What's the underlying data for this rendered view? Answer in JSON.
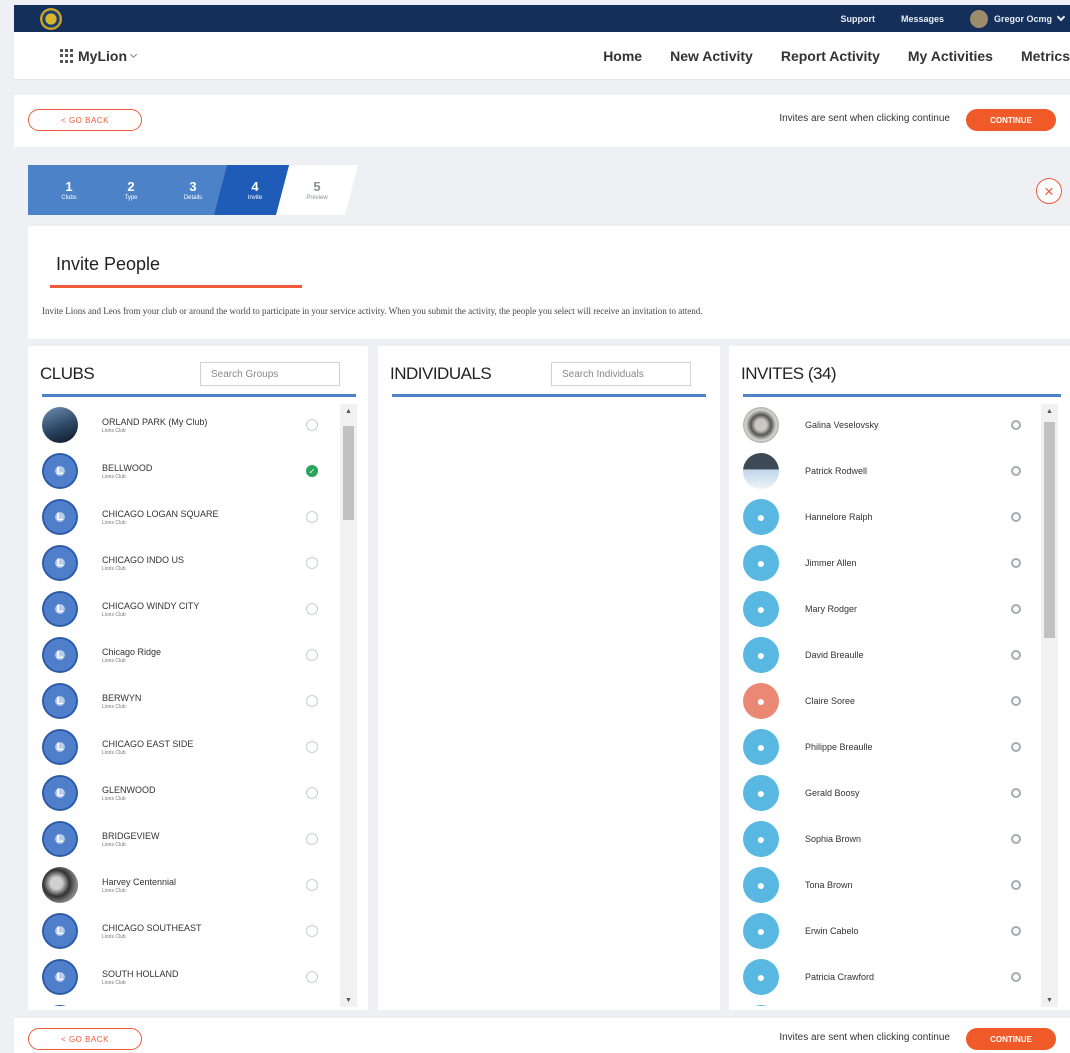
{
  "topbar": {
    "links": [
      "Support",
      "Messages"
    ],
    "user_name": "Gregor Ocmg"
  },
  "navbar": {
    "brand": "MyLion",
    "links": [
      "Home",
      "New Activity",
      "Report Activity",
      "My Activities",
      "Metrics"
    ]
  },
  "action_bar": {
    "back_label": "< GO BACK",
    "hint": "Invites are sent when clicking continue",
    "continue_label": "CONTINUE"
  },
  "steps": [
    {
      "num": "1",
      "label": "Clubs"
    },
    {
      "num": "2",
      "label": "Type"
    },
    {
      "num": "3",
      "label": "Details"
    },
    {
      "num": "4",
      "label": "Invite"
    },
    {
      "num": "5",
      "label": "Preview"
    }
  ],
  "close_symbol": "×",
  "invite": {
    "title": "Invite People",
    "description": "Invite Lions and Leos from your club or around the world to participate in your service activity. When you submit the activity, the people you select will receive an invitation to attend."
  },
  "clubs": {
    "title": "CLUBS",
    "search_placeholder": "Search Groups",
    "items": [
      {
        "name": "ORLAND PARK (My Club)",
        "sub": "Lions Club",
        "selected": false,
        "avatar": "photo1"
      },
      {
        "name": "BELLWOOD",
        "sub": "Lions Club",
        "selected": true,
        "avatar": "club"
      },
      {
        "name": "CHICAGO LOGAN SQUARE",
        "sub": "Lions Club",
        "selected": false,
        "avatar": "club"
      },
      {
        "name": "CHICAGO INDO US",
        "sub": "Lions Club",
        "selected": false,
        "avatar": "club"
      },
      {
        "name": "CHICAGO WINDY CITY",
        "sub": "Lions Club",
        "selected": false,
        "avatar": "club"
      },
      {
        "name": "Chicago Ridge",
        "sub": "Lions Club",
        "selected": false,
        "avatar": "club"
      },
      {
        "name": "BERWYN",
        "sub": "Lions Club",
        "selected": false,
        "avatar": "club"
      },
      {
        "name": "CHICAGO EAST SIDE",
        "sub": "Lions Club",
        "selected": false,
        "avatar": "club"
      },
      {
        "name": "GLENWOOD",
        "sub": "Lions Club",
        "selected": false,
        "avatar": "club"
      },
      {
        "name": "BRIDGEVIEW",
        "sub": "Lions Club",
        "selected": false,
        "avatar": "club"
      },
      {
        "name": "Harvey Centennial",
        "sub": "Lions Club",
        "selected": false,
        "avatar": "photo2"
      },
      {
        "name": "CHICAGO SOUTHEAST",
        "sub": "Lions Club",
        "selected": false,
        "avatar": "club"
      },
      {
        "name": "SOUTH HOLLAND",
        "sub": "Lions Club",
        "selected": false,
        "avatar": "club"
      },
      {
        "name": "",
        "sub": "",
        "selected": false,
        "avatar": "club"
      }
    ]
  },
  "individuals": {
    "title": "INDIVIDUALS",
    "search_placeholder": "Search Individuals"
  },
  "invites": {
    "title": "INVITES (34)",
    "items": [
      {
        "name": "Galina Veselovsky",
        "avatar": "photoA"
      },
      {
        "name": "Patrick Rodwell",
        "avatar": "photoB"
      },
      {
        "name": "Hannelore Ralph",
        "avatar": "person"
      },
      {
        "name": "Jimmer Allen",
        "avatar": "person"
      },
      {
        "name": "Mary Rodger",
        "avatar": "person"
      },
      {
        "name": "David Breaulle",
        "avatar": "person"
      },
      {
        "name": "Claire Soree",
        "avatar": "person-orange"
      },
      {
        "name": "Philippe Breaulle",
        "avatar": "person"
      },
      {
        "name": "Gerald Boosy",
        "avatar": "person"
      },
      {
        "name": "Sophia Brown",
        "avatar": "person"
      },
      {
        "name": "Tona Brown",
        "avatar": "person"
      },
      {
        "name": "Erwin Cabelo",
        "avatar": "person"
      },
      {
        "name": "Patricia Crawford",
        "avatar": "person"
      },
      {
        "name": "",
        "avatar": "person"
      }
    ]
  },
  "icons": {
    "grid": "app-grid-icon",
    "chevron": "chevron-down-icon",
    "close": "close-icon",
    "check": "check-icon",
    "remove": "remove-icon",
    "person": "person-icon"
  },
  "colors": {
    "topbar": "#14305a",
    "accent_orange": "#f05a28",
    "step_blue": "#4c82c8",
    "step_active": "#1f5cb8",
    "selected_green": "#27a65a",
    "person_avatar": "#58b8e2"
  }
}
